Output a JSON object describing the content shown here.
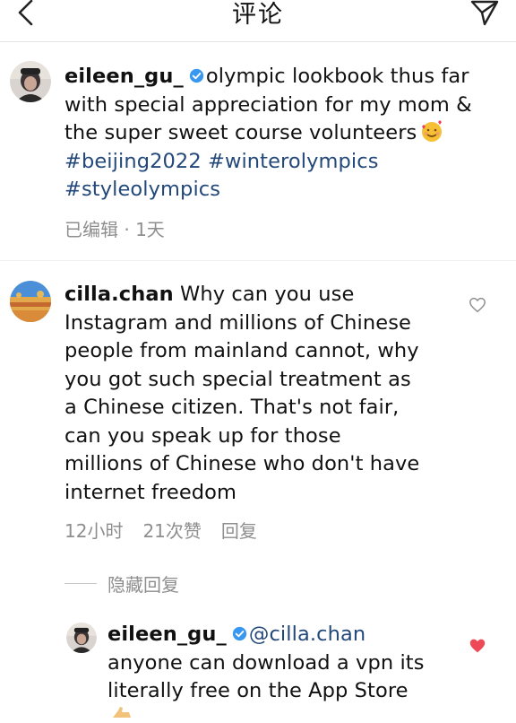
{
  "header": {
    "title": "评论"
  },
  "caption": {
    "username": "eileen_gu_",
    "text_line1": "olympic lookbook thus far",
    "text_line2": "with special appreciation for my mom &",
    "text_line3": "the super sweet course volunteers",
    "hashtags_line1": "#beijing2022 #winterolympics",
    "hashtags_line2": "#styleolympics",
    "meta": "已编辑 · 1天"
  },
  "comment": {
    "username": "cilla.chan",
    "text_line1": "Why can you use",
    "lines": [
      "Instagram and millions of Chinese",
      "people from mainland cannot, why",
      "you got such special treatment as",
      "a Chinese citizen. That's not fair,",
      "can you speak up for those",
      "millions of Chinese who don't have",
      "internet freedom"
    ],
    "time": "12小时",
    "likes": "21次赞",
    "reply_label": "回复",
    "hide_replies": "隐藏回复"
  },
  "reply": {
    "username": "eileen_gu_",
    "mention": "@cilla.chan",
    "line1": "anyone can download a vpn its",
    "line2": "literally free on the App Store"
  },
  "icons": {
    "back": "chevron-left-icon",
    "send": "paper-plane-icon",
    "verified": "verified-badge-icon",
    "heart_outline": "heart-outline-icon",
    "heart_filled": "heart-filled-icon",
    "emoji": "smiling-face-with-hearts-emoji"
  },
  "colors": {
    "hashtag": "#23487a",
    "verified": "#3897f0",
    "like": "#ed4956",
    "meta": "#8e8e8e"
  }
}
